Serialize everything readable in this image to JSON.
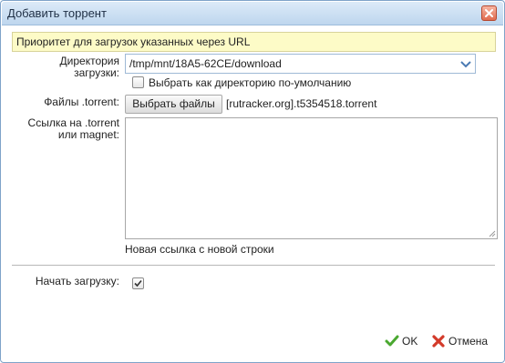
{
  "dialog": {
    "title": "Добавить торрент",
    "close_icon": "close-icon"
  },
  "banner": {
    "text": "Приоритет для загрузок указанных через URL",
    "color": "#fdfbc7"
  },
  "directory": {
    "label_line1": "Директория",
    "label_line2": "загрузки:",
    "value": "/tmp/mnt/18A5-62CE/download",
    "default_checkbox_label": "Выбрать как директорию по-умолчанию",
    "default_checked": false
  },
  "files": {
    "label": "Файлы .torrent:",
    "choose_button": "Выбрать файлы",
    "selected_file": "[rutracker.org].t5354518.torrent"
  },
  "link": {
    "label_line1": "Ссылка на .torrent",
    "label_line2": "или magnet:",
    "value": "",
    "hint": "Новая ссылка с новой строки"
  },
  "start": {
    "label": "Начать загрузку:",
    "checked": true
  },
  "actions": {
    "ok": "OK",
    "cancel": "Отмена",
    "ok_icon": "checkmark-icon",
    "cancel_icon": "cross-icon"
  }
}
